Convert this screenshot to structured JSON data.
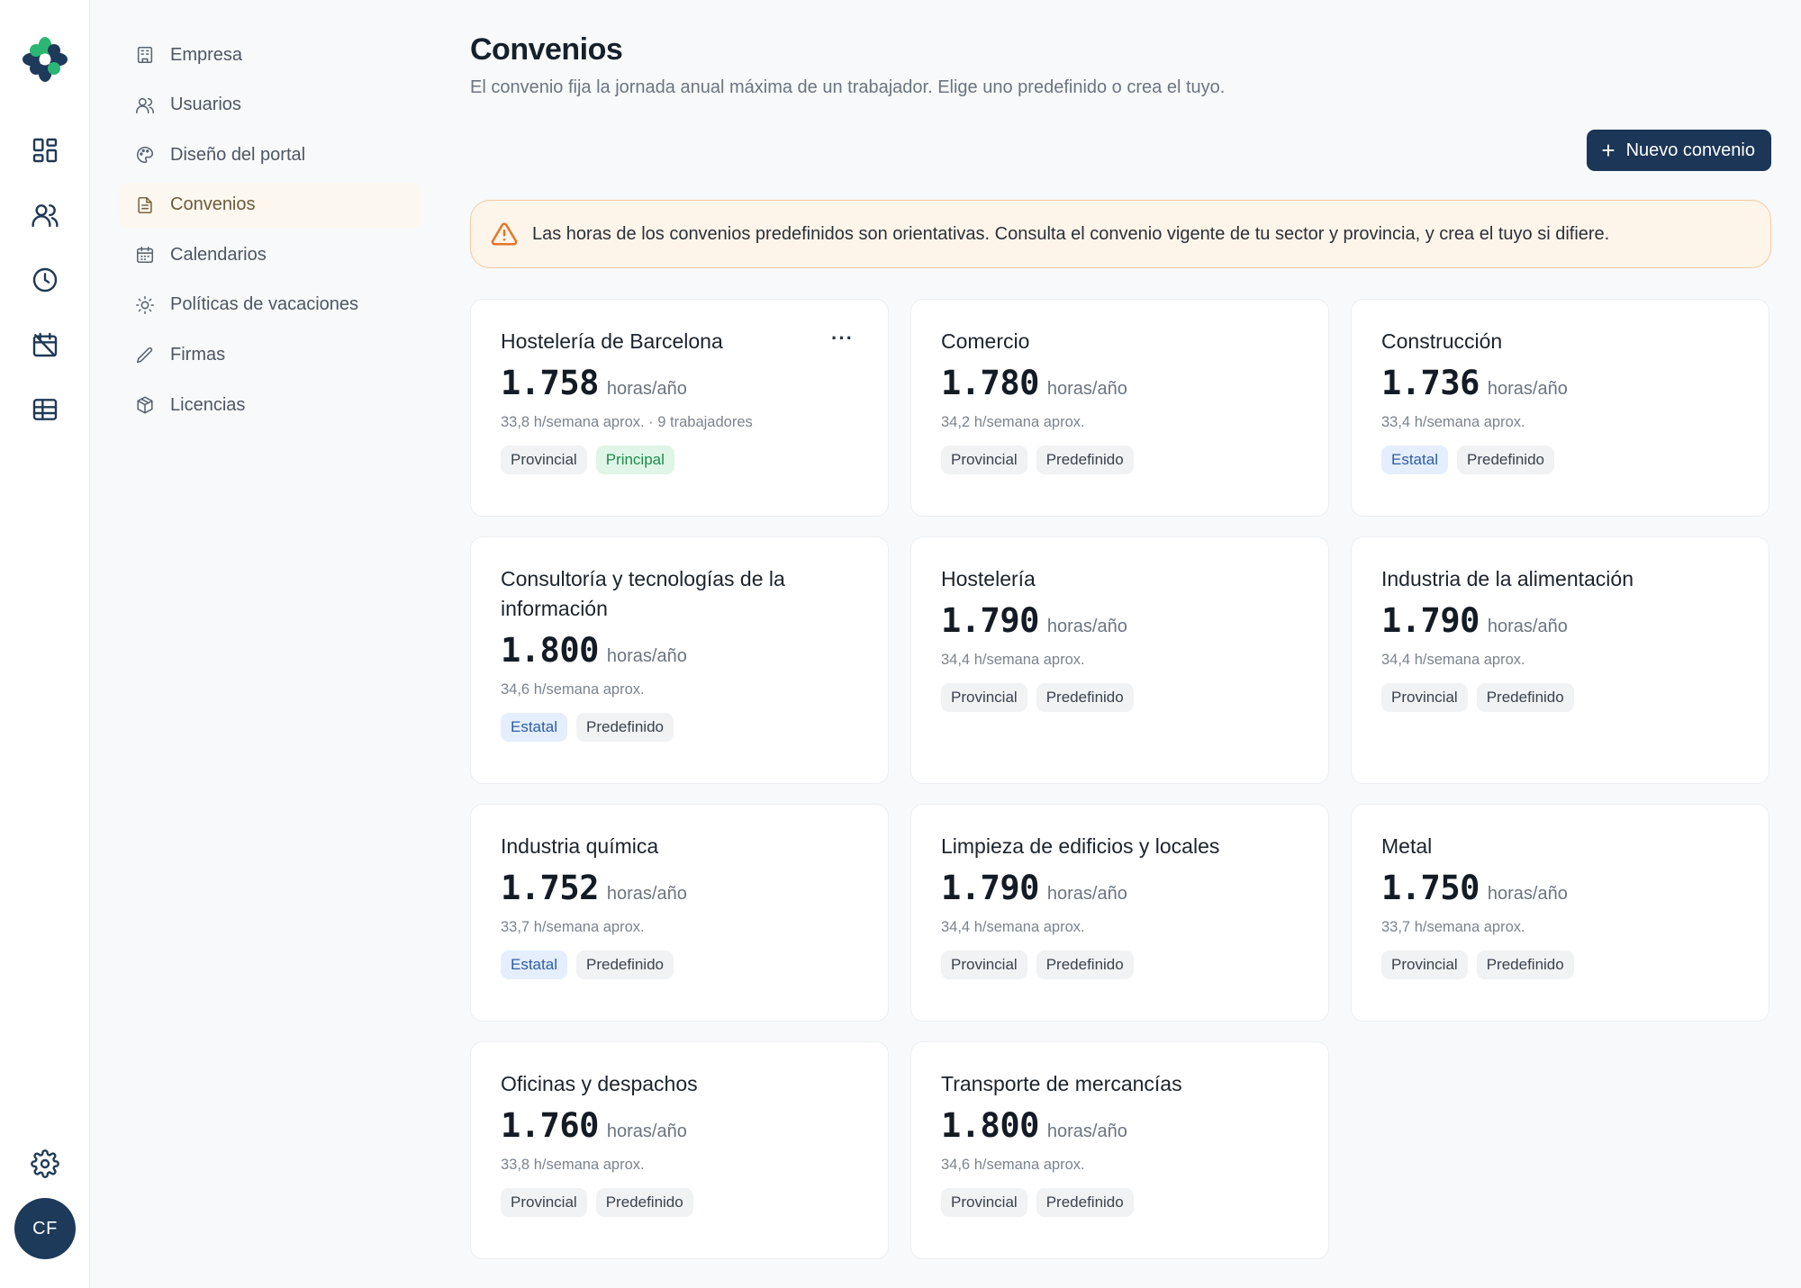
{
  "user": {
    "initials": "CF"
  },
  "subnav": [
    {
      "label": "Empresa",
      "icon": "building-icon"
    },
    {
      "label": "Usuarios",
      "icon": "users-icon"
    },
    {
      "label": "Diseño del portal",
      "icon": "palette-icon"
    },
    {
      "label": "Convenios",
      "icon": "document-icon",
      "active": true
    },
    {
      "label": "Calendarios",
      "icon": "calendar-icon"
    },
    {
      "label": "Políticas de vacaciones",
      "icon": "sun-icon"
    },
    {
      "label": "Firmas",
      "icon": "pen-icon"
    },
    {
      "label": "Licencias",
      "icon": "package-icon"
    }
  ],
  "header": {
    "title": "Convenios",
    "subtitle": "El convenio fija la jornada anual máxima de un trabajador. Elige uno predefinido o crea el tuyo.",
    "new_button": "Nuevo convenio"
  },
  "alert": {
    "text": "Las horas de los convenios predefinidos son orientativas. Consulta el convenio vigente de tu sector y provincia, y crea el tuyo si difiere."
  },
  "units": {
    "hours": "horas/año"
  },
  "cards": [
    {
      "title": "Hostelería de Barcelona",
      "hours": "1.758",
      "meta": "33,8 h/semana aprox. · 9 trabajadores",
      "tags": [
        "Provincial",
        "Principal"
      ],
      "more": "···"
    },
    {
      "title": "Comercio",
      "hours": "1.780",
      "meta": "34,2 h/semana aprox.",
      "tags": [
        "Provincial",
        "Predefinido"
      ]
    },
    {
      "title": "Construcción",
      "hours": "1.736",
      "meta": "33,4 h/semana aprox.",
      "tags": [
        "Estatal",
        "Predefinido"
      ]
    },
    {
      "title": "Consultoría y tecnologías de la información",
      "hours": "1.800",
      "meta": "34,6 h/semana aprox.",
      "tags": [
        "Estatal",
        "Predefinido"
      ]
    },
    {
      "title": "Hostelería",
      "hours": "1.790",
      "meta": "34,4 h/semana aprox.",
      "tags": [
        "Provincial",
        "Predefinido"
      ]
    },
    {
      "title": "Industria de la alimentación",
      "hours": "1.790",
      "meta": "34,4 h/semana aprox.",
      "tags": [
        "Provincial",
        "Predefinido"
      ]
    },
    {
      "title": "Industria química",
      "hours": "1.752",
      "meta": "33,7 h/semana aprox.",
      "tags": [
        "Estatal",
        "Predefinido"
      ]
    },
    {
      "title": "Limpieza de edificios y locales",
      "hours": "1.790",
      "meta": "34,4 h/semana aprox.",
      "tags": [
        "Provincial",
        "Predefinido"
      ]
    },
    {
      "title": "Metal",
      "hours": "1.750",
      "meta": "33,7 h/semana aprox.",
      "tags": [
        "Provincial",
        "Predefinido"
      ]
    },
    {
      "title": "Oficinas y despachos",
      "hours": "1.760",
      "meta": "33,8 h/semana aprox.",
      "tags": [
        "Provincial",
        "Predefinido"
      ]
    },
    {
      "title": "Transporte de mercancías",
      "hours": "1.800",
      "meta": "34,6 h/semana aprox.",
      "tags": [
        "Provincial",
        "Predefinido"
      ]
    }
  ],
  "colors": {
    "brand": "#1b3656",
    "accent_green": "#2bb673",
    "warning": "#e8742a"
  }
}
